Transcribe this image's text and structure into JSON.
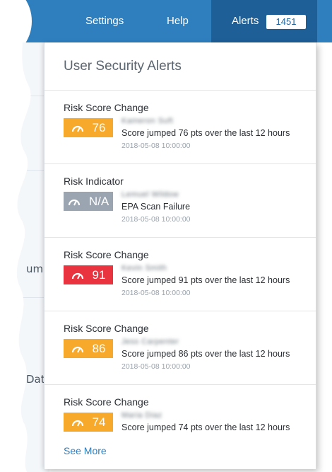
{
  "nav": {
    "settings": "Settings",
    "help": "Help",
    "alerts": "Alerts",
    "alert_count": "1451"
  },
  "background": {
    "text_1": "um",
    "text_2": "Dat"
  },
  "panel": {
    "title": "User Security Alerts",
    "see_more": "See More",
    "alerts": [
      {
        "type": "Risk Score Change",
        "score": "76",
        "user": "Kameron Suft",
        "message": "Score jumped 76 pts over the last 12 hours",
        "time": "2018-05-08 10:00:00",
        "color": "#f7a92b"
      },
      {
        "type": "Risk Indicator",
        "score": "N/A",
        "user": "Lemuel Wildow",
        "message": "EPA Scan Failure",
        "time": "2018-05-08 10:00:00",
        "color": "#9aa5b1"
      },
      {
        "type": "Risk Score Change",
        "score": "91",
        "user": "Kevin Smith",
        "message": "Score jumped 91 pts over the last 12 hours",
        "time": "2018-05-08 10:00:00",
        "color": "#e9343f"
      },
      {
        "type": "Risk Score Change",
        "score": "86",
        "user": "Jess Carpenter",
        "message": "Score jumped 86 pts over the last 12 hours",
        "time": "2018-05-08 10:00:00",
        "color": "#f7a92b"
      },
      {
        "type": "Risk Score Change",
        "score": "74",
        "user": "Maria Diaz",
        "message": "Score jumped 74 pts over the last 12 hours",
        "time": "",
        "color": "#f7a92b"
      }
    ]
  },
  "colors": {
    "nav_bg": "#2f7fbf",
    "nav_active": "#1f5f97",
    "link": "#2f7fbf"
  }
}
